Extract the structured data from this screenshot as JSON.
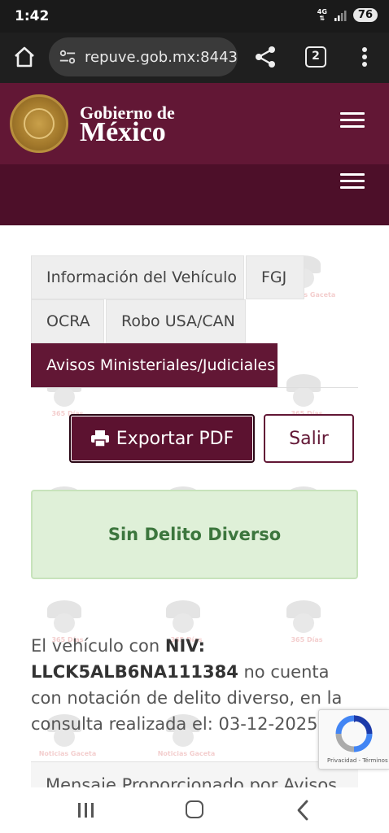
{
  "status_bar": {
    "time": "1:42",
    "network": "4G",
    "battery": "76"
  },
  "browser": {
    "url": "repuve.gob.mx:8443",
    "tab_count": "2",
    "icons": [
      "home-icon",
      "site-settings-icon",
      "share-icon",
      "tabs-icon",
      "more-vert-icon"
    ]
  },
  "header": {
    "title_line1": "Gobierno de",
    "title_line2": "México",
    "seal_icon": "mexico-seal-icon",
    "menu_icon": "hamburger-icon"
  },
  "tabs": [
    {
      "label": "Información del Vehículo",
      "active": false
    },
    {
      "label": "FGJ",
      "active": false
    },
    {
      "label": "OCRA",
      "active": false
    },
    {
      "label": "Robo USA/CAN",
      "active": false
    },
    {
      "label": "Avisos Ministeriales/Judiciales",
      "active": true
    }
  ],
  "actions": {
    "export_label": "Exportar PDF",
    "export_icon": "printer-icon",
    "exit_label": "Salir"
  },
  "alert": {
    "text": "Sin Delito Diverso"
  },
  "result": {
    "prefix": "El vehículo con ",
    "niv_label": "NIV:",
    "niv_value": "LLCK5ALB6NA111384",
    "suffix": " no cuenta con notación de delito diverso, en la consulta realizada el: ",
    "date": "03-12-2025"
  },
  "section_heading": "Mensaje Proporcionado por Avisos",
  "recaptcha": {
    "privacy": "Privacidad",
    "separator": " - ",
    "terms": "Términos"
  },
  "watermark": {
    "text_line1": "Noticias Gaceta",
    "text_line2": "365 Días"
  },
  "colors": {
    "brand": "#621735",
    "brand_dark": "#4d0f29",
    "alert_bg": "#dff0d8",
    "alert_text": "#3c763d"
  },
  "nav_icons": [
    "recents-icon",
    "home-icon",
    "back-icon"
  ]
}
